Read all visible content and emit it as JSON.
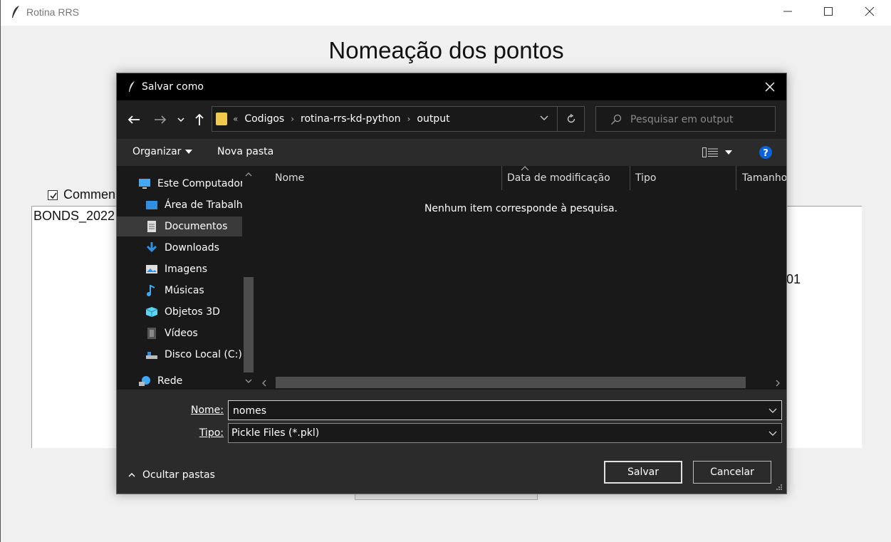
{
  "main": {
    "title": "Rotina RRS",
    "heading": "Nomeação dos pontos",
    "checkbox_label": "Commen",
    "text_line1": "BONDS_2022",
    "text_line2": "01"
  },
  "dialog": {
    "title": "Salvar como",
    "breadcrumb": [
      "Codigos",
      "rotina-rrs-kd-python",
      "output"
    ],
    "breadcrumb_overflow": "«",
    "search_placeholder": "Pesquisar em output",
    "toolbar": {
      "organize": "Organizar",
      "new_folder": "Nova pasta"
    },
    "nav_items": [
      {
        "label": "Este Computador",
        "icon": "computer-icon"
      },
      {
        "label": "Área de Trabalho",
        "icon": "desktop-icon"
      },
      {
        "label": "Documentos",
        "icon": "documents-icon"
      },
      {
        "label": "Downloads",
        "icon": "downloads-icon"
      },
      {
        "label": "Imagens",
        "icon": "pictures-icon"
      },
      {
        "label": "Músicas",
        "icon": "music-icon"
      },
      {
        "label": "Objetos 3D",
        "icon": "objects-3d-icon"
      },
      {
        "label": "Vídeos",
        "icon": "videos-icon"
      },
      {
        "label": "Disco Local (C:)",
        "icon": "disk-icon"
      },
      {
        "label": "Rede",
        "icon": "network-icon"
      }
    ],
    "columns": [
      "Nome",
      "Data de modificação",
      "Tipo",
      "Tamanho"
    ],
    "empty_message": "Nenhum item corresponde à pesquisa.",
    "name_label": "Nome:",
    "name_value": "nomes",
    "type_label": "Tipo:",
    "type_value": "Pickle Files (*.pkl)",
    "hide_folders": "Ocultar pastas",
    "save_label": "Salvar",
    "cancel_label": "Cancelar"
  },
  "colors": {
    "dialog_bg": "#2b2b2b",
    "pane_bg": "#191919",
    "title_bar": "#000000",
    "help": "#0a64d8",
    "folder": "#f2c94c"
  }
}
